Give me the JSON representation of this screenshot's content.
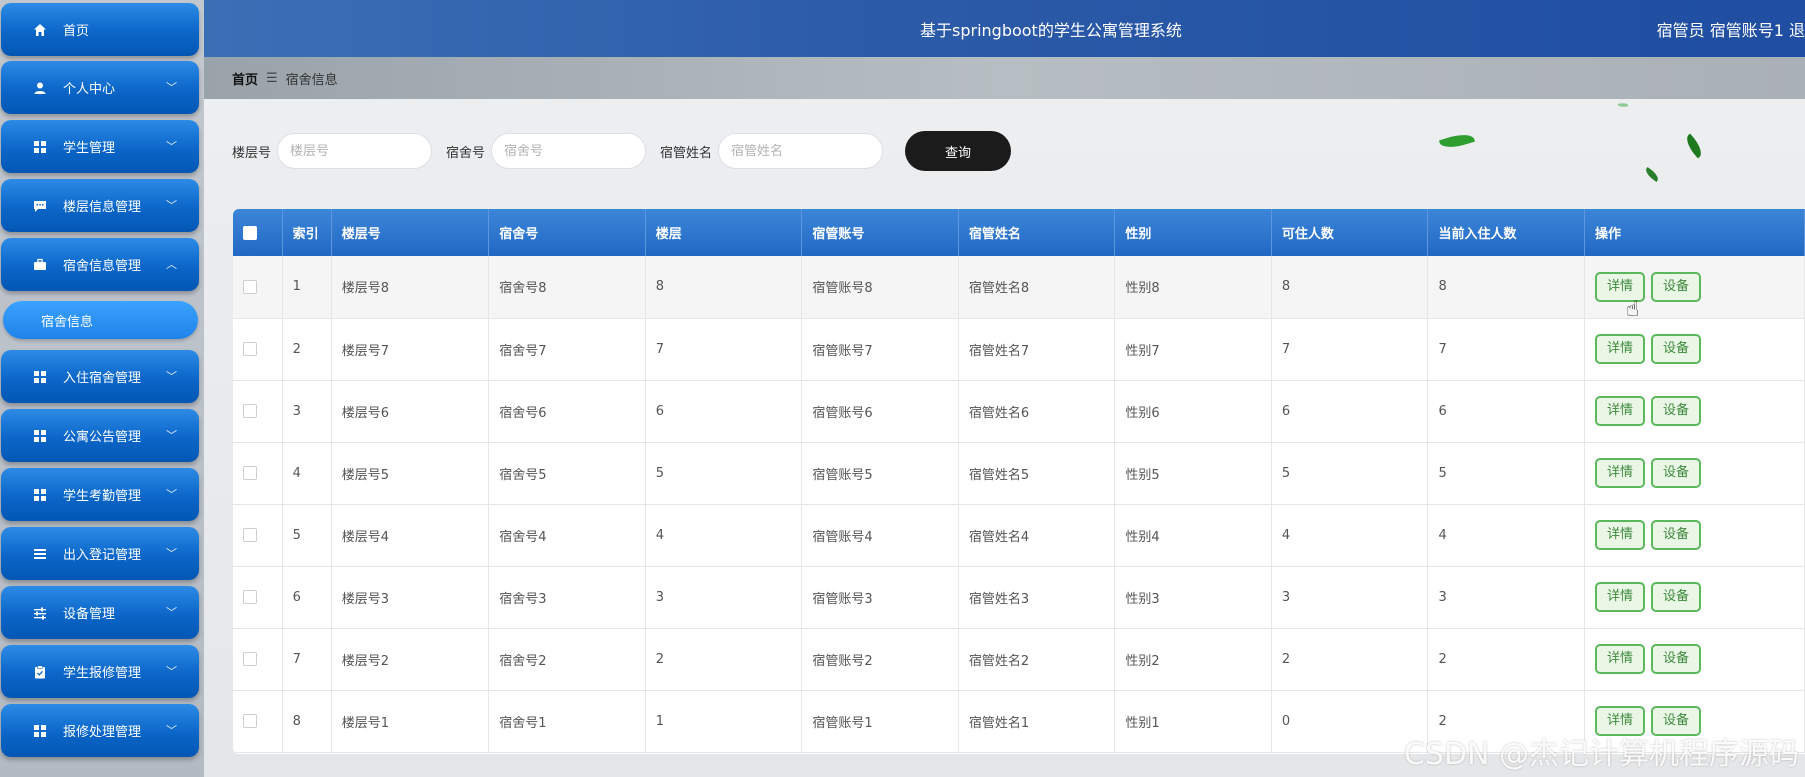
{
  "header": {
    "title": "基于springboot的学生公寓管理系统",
    "user": "宿管员 宿管账号1  退"
  },
  "sidebar": {
    "items": [
      {
        "label": "首页",
        "icon": "home-icon",
        "chevron": ""
      },
      {
        "label": "个人中心",
        "icon": "user-icon",
        "chevron": "﹀"
      },
      {
        "label": "学生管理",
        "icon": "grid-icon",
        "chevron": "﹀"
      },
      {
        "label": "楼层信息管理",
        "icon": "chat-icon",
        "chevron": "﹀"
      },
      {
        "label": "宿舍信息管理",
        "icon": "briefcase-icon",
        "chevron": "︿"
      },
      {
        "label": "入住宿舍管理",
        "icon": "grid-icon",
        "chevron": "﹀"
      },
      {
        "label": "公寓公告管理",
        "icon": "grid-icon",
        "chevron": "﹀"
      },
      {
        "label": "学生考勤管理",
        "icon": "grid-icon",
        "chevron": "﹀"
      },
      {
        "label": "出入登记管理",
        "icon": "list-icon",
        "chevron": "﹀"
      },
      {
        "label": "设备管理",
        "icon": "sliders-icon",
        "chevron": "﹀"
      },
      {
        "label": "学生报修管理",
        "icon": "clipboard-icon",
        "chevron": "﹀"
      },
      {
        "label": "报修处理管理",
        "icon": "grid-icon",
        "chevron": "﹀"
      }
    ],
    "subitem": "宿舍信息"
  },
  "breadcrumb": {
    "home": "首页",
    "separator": "☰",
    "current": "宿舍信息"
  },
  "search": {
    "floor_label": "楼层号",
    "floor_placeholder": "楼层号",
    "room_label": "宿舍号",
    "room_placeholder": "宿舍号",
    "manager_label": "宿管姓名",
    "manager_placeholder": "宿管姓名",
    "query_label": "查询"
  },
  "table": {
    "columns": [
      "索引",
      "楼层号",
      "宿舍号",
      "楼层",
      "宿管账号",
      "宿管姓名",
      "性别",
      "可住人数",
      "当前入住人数",
      "操作"
    ],
    "rows": [
      [
        "1",
        "楼层号8",
        "宿舍号8",
        "8",
        "宿管账号8",
        "宿管姓名8",
        "性别8",
        "8",
        "8"
      ],
      [
        "2",
        "楼层号7",
        "宿舍号7",
        "7",
        "宿管账号7",
        "宿管姓名7",
        "性别7",
        "7",
        "7"
      ],
      [
        "3",
        "楼层号6",
        "宿舍号6",
        "6",
        "宿管账号6",
        "宿管姓名6",
        "性别6",
        "6",
        "6"
      ],
      [
        "4",
        "楼层号5",
        "宿舍号5",
        "5",
        "宿管账号5",
        "宿管姓名5",
        "性别5",
        "5",
        "5"
      ],
      [
        "5",
        "楼层号4",
        "宿舍号4",
        "4",
        "宿管账号4",
        "宿管姓名4",
        "性别4",
        "4",
        "4"
      ],
      [
        "6",
        "楼层号3",
        "宿舍号3",
        "3",
        "宿管账号3",
        "宿管姓名3",
        "性别3",
        "3",
        "3"
      ],
      [
        "7",
        "楼层号2",
        "宿舍号2",
        "2",
        "宿管账号2",
        "宿管姓名2",
        "性别2",
        "2",
        "2"
      ],
      [
        "8",
        "楼层号1",
        "宿舍号1",
        "1",
        "宿管账号1",
        "宿管姓名1",
        "性别1",
        "0",
        "2"
      ]
    ],
    "detail_label": "详情",
    "device_label": "设备"
  },
  "watermark": "CSDN @杰记计算机程序源码",
  "colors": {
    "menu_blue": "#0b66c8",
    "header_blue": "#2b5aa8",
    "table_header": "#2168c4",
    "action_green": "#5cb85c",
    "query_black": "#1b1b1b"
  }
}
